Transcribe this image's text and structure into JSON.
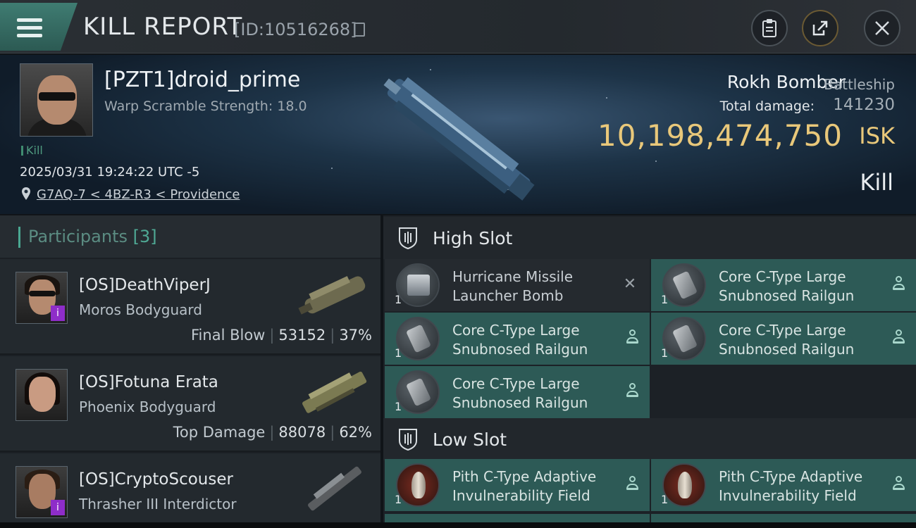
{
  "header": {
    "title": "KILL REPORT",
    "report_id": "[ID:10516268]"
  },
  "victim": {
    "name": "[PZT1]droid_prime",
    "warp_scramble": "Warp Scramble Strength: 18.0",
    "tag": "Kill",
    "timestamp": "2025/03/31 19:24:22 UTC -5",
    "location": "G7AQ-7 < 4BZ-R3 < Providence",
    "ship_name": "Rokh Bomber",
    "ship_class": "Battleship",
    "total_damage_label": "Total damage:",
    "total_damage": "141230",
    "isk_value": "10,198,474,750",
    "isk_unit": "ISK",
    "result": "Kill"
  },
  "participants": {
    "title": "Participants",
    "count": "[3]",
    "rows": [
      {
        "name": "[OS]DeathViperJ",
        "ship": "Moros Bodyguard",
        "stat_label": "Final Blow",
        "damage": "53152",
        "percent": "37%"
      },
      {
        "name": "[OS]Fotuna Erata",
        "ship": "Phoenix Bodyguard",
        "stat_label": "Top Damage",
        "damage": "88078",
        "percent": "62%"
      },
      {
        "name": "[OS]CryptoScouser",
        "ship": "Thrasher III Interdictor"
      }
    ]
  },
  "slots": {
    "high": {
      "title": "High Slot",
      "modules": [
        {
          "name": "Hurricane Missile Launcher Bomb",
          "qty": "1"
        },
        {
          "name": "Core C-Type Large Snubnosed Railgun",
          "qty": "1"
        },
        {
          "name": "Core C-Type Large Snubnosed Railgun",
          "qty": "1"
        },
        {
          "name": "Core C-Type Large Snubnosed Railgun",
          "qty": "1"
        },
        {
          "name": "Core C-Type Large Snubnosed Railgun",
          "qty": "1"
        }
      ]
    },
    "low": {
      "title": "Low Slot",
      "modules": [
        {
          "name": "Pith C-Type Adaptive Invulnerability Field",
          "qty": "1"
        },
        {
          "name": "Pith C-Type Adaptive Invulnerability Field",
          "qty": "1"
        }
      ]
    }
  },
  "icons": {
    "destroyed": "close-icon",
    "dropped": "person-icon"
  },
  "colors": {
    "accent": "#4aa892",
    "isk": "#e9c87a",
    "fitted_bg": "#2d5a56",
    "badge": "#8e2dc9"
  }
}
